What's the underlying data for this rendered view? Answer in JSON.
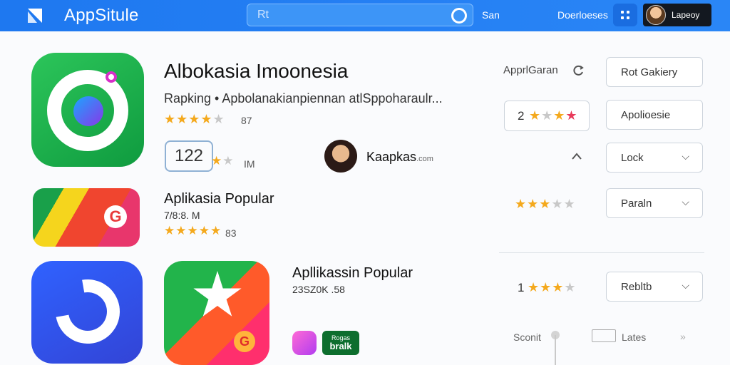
{
  "header": {
    "title": "AppSitule",
    "search_value": "Rt",
    "nav_link_1": "San",
    "nav_link_2": "Doerloeses",
    "user_name": "Lapeoy"
  },
  "featured": {
    "title": "Albokasia Imoonesia",
    "subtitle": "Rapking • Apbolanakianpiennan atlSppoharaulr...",
    "stars": "★★★★",
    "stars_off": "★",
    "rating_count": "87",
    "badge": "122",
    "mini_stars_on": "★",
    "mini_stars_off": "★",
    "mini_label": "IM",
    "developer": "Kaapkas",
    "developer_domain": ".com"
  },
  "right_panel": {
    "label_1": "ApprlGaran",
    "label_1_icon": "refresh-icon",
    "btn_1": "Rot Gakiery",
    "rate_num": "2",
    "btn_2": "Apolioesie",
    "btn_3": "Lock",
    "btn_4": "Paraln",
    "btn_5": "Rebltb",
    "rate_row_1_prefix": "",
    "rate_row_2_prefix": "1"
  },
  "section_1": {
    "title": "Aplikasia Popular",
    "meta": "7/8:8. M",
    "rating_count": "83"
  },
  "section_2": {
    "title": "Apllikassin Popular",
    "meta": "23SZ0K .58",
    "mini2_top": "Rogas",
    "mini2_bottom": "bralk"
  },
  "bottom": {
    "label_1": "Sconit",
    "label_2": "Lates"
  },
  "colors": {
    "topbar": "#1e78f0",
    "star": "#f4a91d",
    "star_off": "#c8c8c8",
    "star_red": "#e83a5a"
  }
}
